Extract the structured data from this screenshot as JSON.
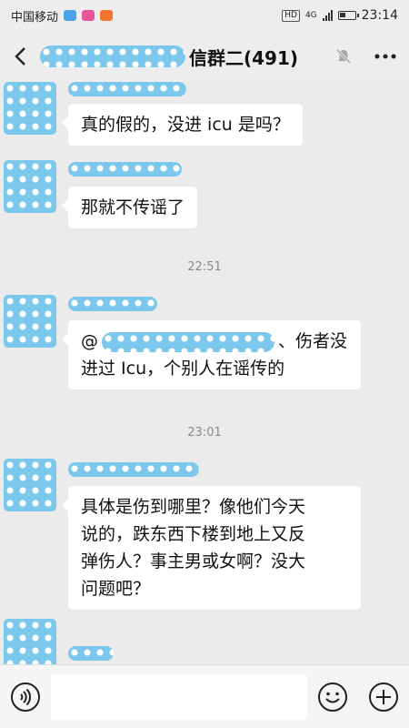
{
  "status_bar": {
    "carrier": "中国移动",
    "network": "4G",
    "hd": "HD",
    "time": "23:14",
    "app_badges": [
      {
        "icon": "blue-app-icon",
        "color": "#4aa3e8"
      },
      {
        "icon": "pink-app-icon",
        "color": "#e8559a"
      },
      {
        "icon": "orange-app-icon",
        "color": "#f2762e"
      }
    ]
  },
  "nav": {
    "title": "信群二(491)",
    "back_icon": "back-arrow-icon",
    "mute_icon": "bell-muted-icon",
    "more_icon": "more-dots-icon"
  },
  "messages": [
    {
      "text": "真的假的，没进 icu 是吗？"
    },
    {
      "text": "那就不传谣了"
    },
    {
      "text_before_mention": "@",
      "text_after_mention_line1": "、伤者没",
      "text_line2": "进过 Icu，个别人在谣传的"
    },
    {
      "lines": [
        "具体是伤到哪里？像他们今天",
        "说的，跌东西下楼到地上又反",
        "弹伤人？事主男或女啊？没大",
        "问题吧？"
      ]
    }
  ],
  "timestamps": [
    "22:51",
    "23:01"
  ],
  "input_bar": {
    "voice_icon": "voice-icon",
    "emoji_icon": "emoji-icon",
    "plus_icon": "plus-icon",
    "placeholder": ""
  },
  "colors": {
    "background": "#ebebeb",
    "bubble": "#ffffff",
    "blur_blue": "#7cc7ec",
    "timestamp": "#8a8a8a"
  }
}
